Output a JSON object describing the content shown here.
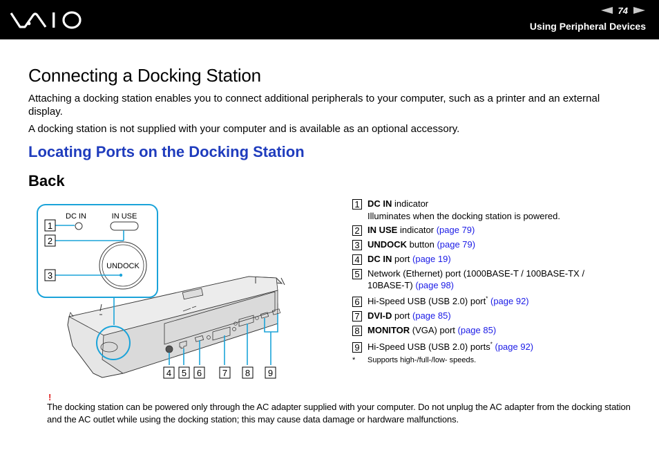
{
  "header": {
    "logo": "VAIO",
    "page_number": "74",
    "prev_icon": "arrow-left-icon",
    "next_icon": "arrow-right-icon",
    "section": "Using Peripheral Devices"
  },
  "content": {
    "title": "Connecting a Docking Station",
    "paragraphs": [
      "Attaching a docking station enables you to connect additional peripherals to your computer, such as a printer and an external display.",
      "A docking station is not supplied with your computer and is available as an optional accessory."
    ],
    "subtitle": "Locating Ports on the Docking Station",
    "view_title": "Back"
  },
  "illustration": {
    "labels": {
      "dc_in": "DC IN",
      "in_use": "IN USE",
      "undock": "UNDOCK"
    },
    "callouts": [
      "1",
      "2",
      "3",
      "4",
      "5",
      "6",
      "7",
      "8",
      "9"
    ],
    "accent_color": "#1aa3d9"
  },
  "legend": {
    "items": [
      {
        "num": "1",
        "bold": "DC IN",
        "text": " indicator",
        "link": "",
        "note": "Illuminates when the docking station is powered."
      },
      {
        "num": "2",
        "bold": "IN USE",
        "text": " indicator ",
        "link": "(page 79)"
      },
      {
        "num": "3",
        "bold": "UNDOCK",
        "text": " button ",
        "link": "(page 79)"
      },
      {
        "num": "4",
        "bold": "DC IN",
        "text": " port ",
        "link": "(page 19)"
      },
      {
        "num": "5",
        "bold": "",
        "text": "Network (Ethernet) port (1000BASE-T / 100BASE-TX /",
        "text2": "10BASE-T) ",
        "link": "(page 98)"
      },
      {
        "num": "6",
        "bold": "",
        "text": "Hi-Speed USB (USB 2.0) port",
        "sup": "*",
        "link": "(page 92)"
      },
      {
        "num": "7",
        "bold": "DVI-D",
        "text": " port ",
        "link": "(page 85)"
      },
      {
        "num": "8",
        "bold": "MONITOR",
        "text": " (VGA) port ",
        "link": "(page 85)"
      },
      {
        "num": "9",
        "bold": "",
        "text": "Hi-Speed USB (USB 2.0) ports",
        "sup": "*",
        "link": "(page 92)"
      }
    ],
    "footnote_mark": "*",
    "footnote": "Supports high-/full-/low- speeds."
  },
  "warning": {
    "mark": "!",
    "text": "The docking station can be powered only through the AC adapter supplied with your computer. Do not unplug the AC adapter from the docking station and the AC outlet while using the docking station; this may cause data damage or hardware malfunctions."
  },
  "colors": {
    "header_bg": "#000000",
    "subtitle": "#1f3cbd",
    "link": "#1a1ae6",
    "warning": "#e02020",
    "callout_line": "#1aa3d9"
  }
}
